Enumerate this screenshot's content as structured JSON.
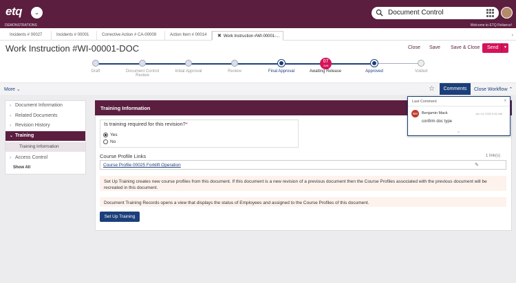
{
  "header": {
    "logo": "etq",
    "search_text": "Document Control",
    "subbar_left": "DEMONSTRATIONS",
    "subbar_right": "Welcome to ETQ Reliance!"
  },
  "tabs": [
    {
      "label": "Incidents # 00027"
    },
    {
      "label": "Incidents # 00001"
    },
    {
      "label": "Corrective Action # CA-00009"
    },
    {
      "label": "Action Item # 00014"
    },
    {
      "label": "Work Instruction #WI-00001-...",
      "active": true
    }
  ],
  "title": "Work Instruction #WI-00001-DOC",
  "actions": {
    "close": "Close",
    "save": "Save",
    "save_close": "Save & Close",
    "send": "Send"
  },
  "workflow": {
    "steps": [
      {
        "label": "Draft",
        "state": "done"
      },
      {
        "label": "Document Control Review",
        "state": "done"
      },
      {
        "label": "Initial Approval",
        "state": "done"
      },
      {
        "label": "Review",
        "state": "done"
      },
      {
        "label": "Final Approval",
        "state": "done"
      },
      {
        "label": "Awaiting Release",
        "state": "current"
      },
      {
        "label": "Approved",
        "state": "active"
      },
      {
        "label": "Voided",
        "state": "todo"
      }
    ],
    "current_day": "07",
    "current_month": "JUN"
  },
  "toolbar": {
    "more": "More",
    "comments": "Comments",
    "close_workflow": "Close Workflow"
  },
  "sidenav": {
    "items": [
      {
        "label": "Document Information"
      },
      {
        "label": "Related Documents"
      },
      {
        "label": "Revision History"
      },
      {
        "label": "Training"
      },
      {
        "label": "Access Control"
      }
    ],
    "sub_item": "Training Information",
    "show_all": "Show All"
  },
  "panel": {
    "heading": "Training Information",
    "question": "Is training required for this revision?",
    "required_mark": "*",
    "option_yes": "Yes",
    "option_no": "No",
    "links_label": "Course Profile Links",
    "links_count": "1 link(s)",
    "link_text": "Course Profile 00025 Forklift Operation",
    "note1": "Set Up Training creates new course profiles from this document.  If this document is a new revision of a previous document then the Course Profiles associated with the previous document will be recreated in this document.",
    "note2": "Document Training Records opens a view that displays the status of Employees and assigned to the Course Profiles of this document.",
    "setup_button": "Set Up Training"
  },
  "comment_popup": {
    "title": "Last Comment",
    "initials": "BM",
    "author": "Benjamin Mack",
    "date": "Jun 13, 2022 8:01 AM",
    "text": "confirm doc type"
  },
  "colors": {
    "brand": "#5b1e3f",
    "accent_blue": "#1b3f7a",
    "send_red": "#d4145a"
  }
}
